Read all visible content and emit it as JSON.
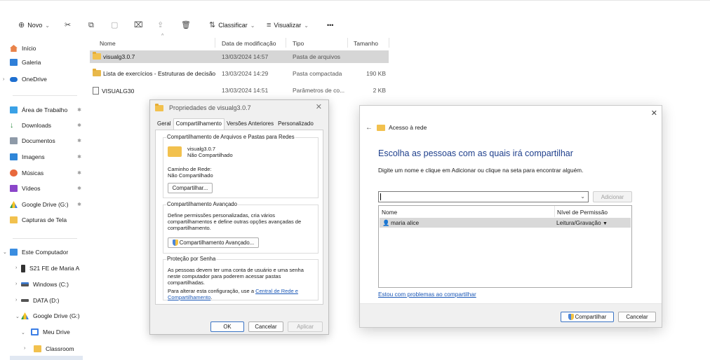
{
  "toolbar": {
    "new_label": "Novo",
    "sort_label": "Classificar",
    "view_label": "Visualizar",
    "more_label": "•••"
  },
  "sidebar": {
    "home": "Início",
    "gallery": "Galeria",
    "onedrive": "OneDrive",
    "desktop": "Área de Trabalho",
    "downloads": "Downloads",
    "documents": "Documentos",
    "images": "Imagens",
    "music": "Músicas",
    "videos": "Vídeos",
    "gdrive_quick": "Google Drive (G:)",
    "screenshots": "Capturas de Tela",
    "this_pc": "Este Computador",
    "phone": "S21 FE de Maria A",
    "windows": "Windows (C:)",
    "data": "DATA (D:)",
    "gdrive": "Google Drive (G:)",
    "my_drive": "Meu Drive",
    "classroom": "Classroom"
  },
  "filelist": {
    "columns": {
      "name": "Nome",
      "modified": "Data de modificação",
      "type": "Tipo",
      "size": "Tamanho"
    },
    "rows": [
      {
        "name": "visualg3.0.7",
        "modified": "13/03/2024 14:57",
        "type": "Pasta de arquivos",
        "size": ""
      },
      {
        "name": "Lista de exercícios - Estruturas de decisão",
        "modified": "13/03/2024 14:29",
        "type": "Pasta compactada",
        "size": "190 KB"
      },
      {
        "name": "VISUALG30",
        "modified": "13/03/2024 14:51",
        "type": "Parâmetros de co...",
        "size": "2 KB"
      }
    ]
  },
  "properties": {
    "title": "Propriedades de visualg3.0.7",
    "tabs": [
      "Geral",
      "Compartilhamento",
      "Versões Anteriores",
      "Personalizado"
    ],
    "group1": {
      "label": "Compartilhamento de Arquivos e Pastas para Redes",
      "folder_name": "visualg3.0.7",
      "status": "Não Compartilhado",
      "path_label": "Caminho de Rede:",
      "path_value": "Não Compartilhado",
      "share_button": "Compartilhar..."
    },
    "group2": {
      "label": "Compartilhamento Avançado",
      "desc": "Define permissões personalizadas, cria vários compartilhamentos e define outras opções avançadas de compartilhamento.",
      "button": "Compartilhamento Avançado..."
    },
    "group3": {
      "label": "Proteção por Senha",
      "desc": "As pessoas devem ter uma conta de usuário e uma senha neste computador para poderem acessar pastas compartilhadas.",
      "change_prefix": "Para alterar esta configuração, use a ",
      "change_link": "Central de Rede e Compartilhamento",
      "change_suffix": "."
    },
    "ok": "OK",
    "cancel": "Cancelar",
    "apply": "Aplicar"
  },
  "share": {
    "header": "Acesso à rede",
    "title": "Escolha as pessoas com as quais irá compartilhar",
    "subtitle": "Digite um nome e clique em Adicionar ou clique na seta para encontrar alguém.",
    "input_value": "",
    "add_button": "Adicionar",
    "col_name": "Nome",
    "col_perm": "Nível de Permissão",
    "user_name": "maria alice",
    "user_perm": "Leitura/Gravação",
    "help_link": "Estou com problemas ao compartilhar",
    "share_button": "Compartilhar",
    "cancel_button": "Cancelar"
  },
  "colors": {
    "accent": "#1e3f8c",
    "link": "#1a57b6",
    "folder": "#f2c14e",
    "selection": "#d6d6d6"
  }
}
